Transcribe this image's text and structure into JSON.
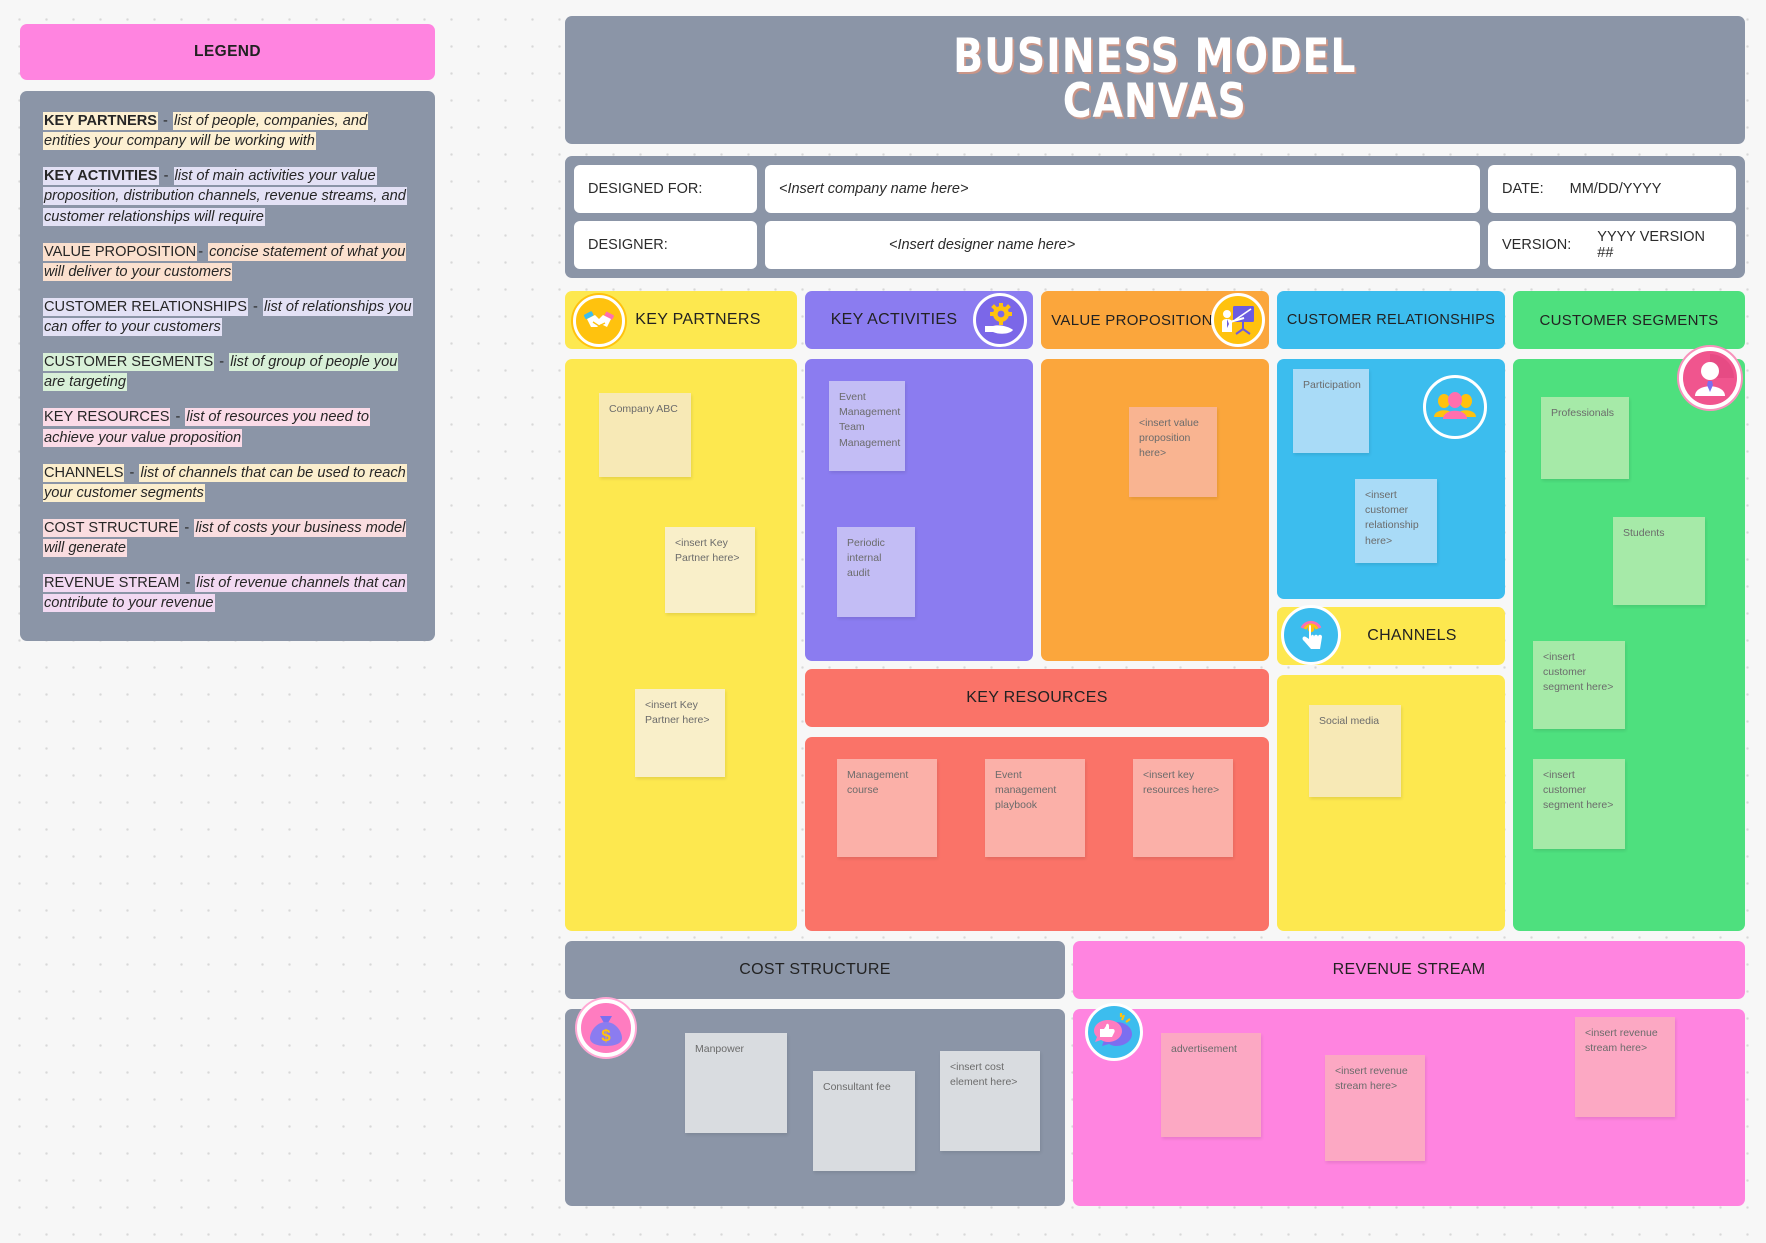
{
  "legend": {
    "title": "LEGEND",
    "entries": [
      {
        "term": "KEY PARTNERS",
        "bold": true,
        "sep": " - ",
        "desc": "list of people, companies, and entities your company will be working with",
        "color": "#fdf0d2"
      },
      {
        "term": "KEY ACTIVITIES",
        "bold": true,
        "sep": " - ",
        "desc": "list of main activities your value proposition, distribution channels, revenue streams, and customer relationships will require",
        "color": "#e3e1f5"
      },
      {
        "term": "VALUE PROPOSITION",
        "bold": false,
        "sep": "- ",
        "desc": "concise statement of what you will deliver to your customers",
        "color": "#fbe0ce"
      },
      {
        "term": "CUSTOMER RELATIONSHIPS",
        "bold": false,
        "sep": " - ",
        "desc": "list of relationships you can offer to your customers",
        "color": "#e3e1f5"
      },
      {
        "term": "CUSTOMER SEGMENTS",
        "bold": false,
        "sep": " - ",
        "desc": "list of group of people you are targeting",
        "color": "#d8f0d8"
      },
      {
        "term": "KEY RESOURCES",
        "bold": false,
        "sep": " - ",
        "desc": "list of resources you need to achieve your value proposition",
        "color": "#fbdbe8"
      },
      {
        "term": "CHANNELS",
        "bold": false,
        "sep": " - ",
        "desc": "list of channels that can be used to reach your customer segments",
        "color": "#fbeecd"
      },
      {
        "term": "COST STRUCTURE",
        "bold": false,
        "sep": " - ",
        "desc": "list of costs your business model will generate",
        "color": "#fadde0"
      },
      {
        "term": "REVENUE STREAM",
        "bold": false,
        "sep": " - ",
        "desc": "list of revenue channels that can contribute to your revenue",
        "color": "#f2d9f2"
      }
    ]
  },
  "canvas": {
    "title_line1": "BUSINESS MODEL",
    "title_line2": "CANVAS",
    "meta": {
      "designed_for_label": "DESIGNED FOR:",
      "company_placeholder": "<Insert company name here>",
      "date_label": "DATE:",
      "date_value": "MM/DD/YYYY",
      "designer_label": "DESIGNER:",
      "designer_placeholder": "<Insert designer name here>",
      "version_label": "VERSION:",
      "version_value": "YYYY VERSION ##"
    },
    "blocks": {
      "key_partners": {
        "title": "KEY PARTNERS",
        "icon": "handshake-icon",
        "notes": [
          "Company ABC",
          "<insert Key Partner here>",
          "<insert Key Partner here>"
        ]
      },
      "key_activities": {
        "title": "KEY ACTIVITIES",
        "icon": "gear-in-hand-icon",
        "notes": [
          "Event Management\nTeam Management",
          "Periodic internal audit"
        ]
      },
      "value_proposition": {
        "title": "VALUE PROPOSITION",
        "icon": "presentation-board-icon",
        "notes": [
          "<insert value proposition here>"
        ]
      },
      "customer_relationships": {
        "title": "CUSTOMER RELATIONSHIPS",
        "icon": "people-group-icon",
        "notes": [
          "Participation",
          "<insert customer relationship here>"
        ]
      },
      "customer_segments": {
        "title": "CUSTOMER SEGMENTS",
        "icon": "person-avatar-icon",
        "notes": [
          "Professionals",
          "Students",
          "<insert customer segment here>",
          "<insert customer segment here>"
        ]
      },
      "key_resources": {
        "title": "KEY RESOURCES",
        "notes": [
          "Management course",
          "Event management playbook",
          "<insert key resources here>"
        ]
      },
      "channels": {
        "title": "CHANNELS",
        "icon": "click-signal-icon",
        "notes": [
          "Social media"
        ]
      },
      "cost_structure": {
        "title": "COST STRUCTURE",
        "icon": "money-bag-icon",
        "notes": [
          "Manpower",
          "Consultant fee",
          "<insert cost element here>"
        ]
      },
      "revenue_stream": {
        "title": "REVENUE STREAM",
        "icon": "thumbs-up-chat-icon",
        "notes": [
          "advertisement",
          "<insert revenue stream here>",
          "<insert revenue stream here>"
        ]
      }
    }
  },
  "colors": {
    "panel_gray": "#8b95a7",
    "legend_pink": "#ff84e0",
    "key_partners": "#fde84f",
    "key_activities": "#8b7cf0",
    "value_proposition": "#fba63c",
    "customer_relationships": "#3cbdee",
    "customer_segments": "#4ee07e",
    "key_resources": "#fa7368",
    "channels": "#fde84f",
    "cost_structure": "#8b95a7",
    "revenue_stream": "#ff84e0"
  }
}
